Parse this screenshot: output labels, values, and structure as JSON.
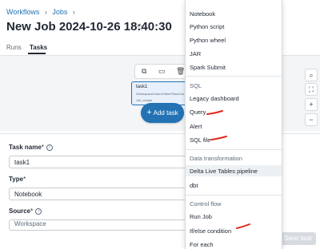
{
  "breadcrumb": {
    "items": [
      "Workflows",
      "Jobs"
    ]
  },
  "page": {
    "title": "New Job 2024-10-26 18:40:30"
  },
  "tabs": [
    {
      "label": "Runs"
    },
    {
      "label": "Tasks"
    }
  ],
  "canvas": {
    "task_node": {
      "name": "task1",
      "path": "/Workspace/Users/OtherFiles/Zoe...",
      "cluster": "Job_cluster"
    },
    "add_task_label": "Add task"
  },
  "form": {
    "task_name_label": "Task name",
    "task_name_value": "task1",
    "type_label": "Type",
    "type_value": "Notebook",
    "source_label": "Source",
    "source_value": "Workspace",
    "save_label": "Save task"
  },
  "dropdown": {
    "items_top": [
      "Notebook",
      "Python script",
      "Python wheel",
      "JAR",
      "Spark Submit"
    ],
    "sql_header": "SQL",
    "sql_items": [
      "Legacy dashboard",
      "Query",
      "Alert",
      "SQL file"
    ],
    "dt_header": "Data transformation",
    "dt_items": [
      "Delta Live Tables pipeline",
      "dbt"
    ],
    "cf_header": "Control flow",
    "cf_items": [
      "Run Job",
      "If/else condition",
      "For each"
    ]
  },
  "colors": {
    "accent": "#2272b4",
    "annotation": "#e0281b"
  }
}
